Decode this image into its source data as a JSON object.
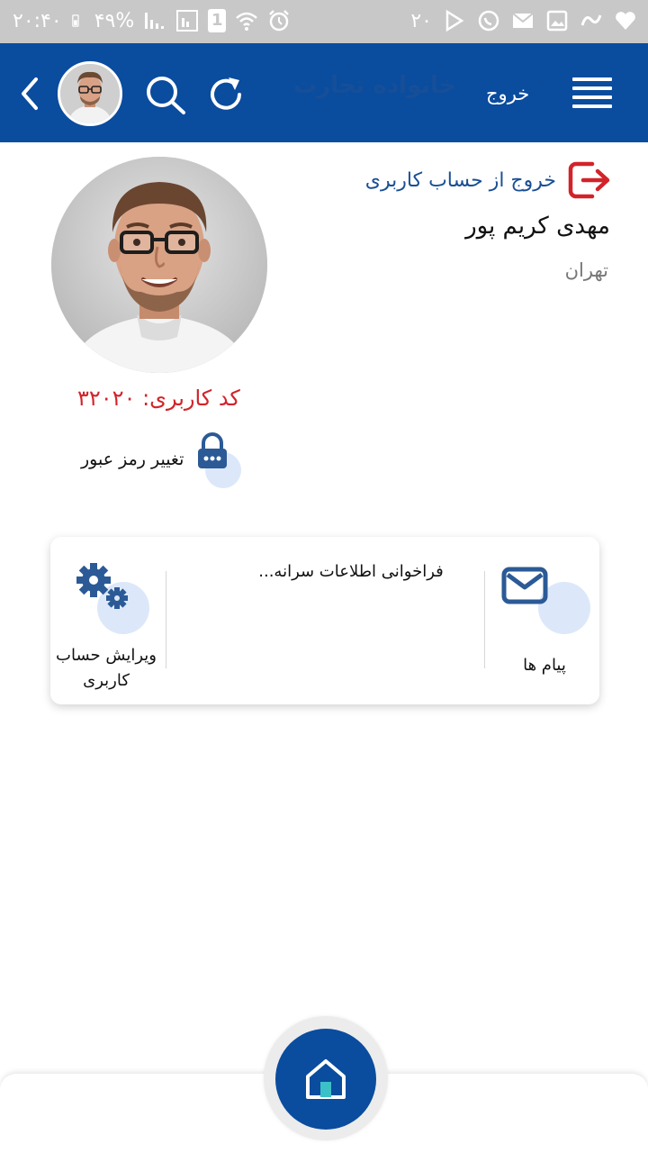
{
  "status_bar": {
    "time": "۲۰:۴۰",
    "battery": "۴۹%",
    "notification_count": "۲۰",
    "sim_slot": "1"
  },
  "header": {
    "brand": "خانواده تجارت",
    "logout_label": "خروج"
  },
  "profile": {
    "logout_account_label": "خروج از حساب کاربری",
    "name": "مهدی کریم پور",
    "city": "تهران",
    "user_code": "کد کاربری: ۳۲۰۲۰",
    "change_password_label": "تغییر رمز عبور"
  },
  "card": {
    "loading_text": "فراخوانی اطلاعات سرانه...",
    "messages_label": "پیام ها",
    "edit_account_label_line1": "ویرایش حساب",
    "edit_account_label_line2": "کاربری"
  },
  "colors": {
    "primary": "#0a4c9e",
    "accent_red": "#d2232a",
    "icon_blue": "#2b5a96",
    "bubble": "#dce8fa"
  },
  "icons": [
    "back-icon",
    "search-icon",
    "refresh-icon",
    "menu-icon",
    "logout-icon",
    "lock-icon",
    "mail-icon",
    "gears-icon",
    "home-icon"
  ]
}
